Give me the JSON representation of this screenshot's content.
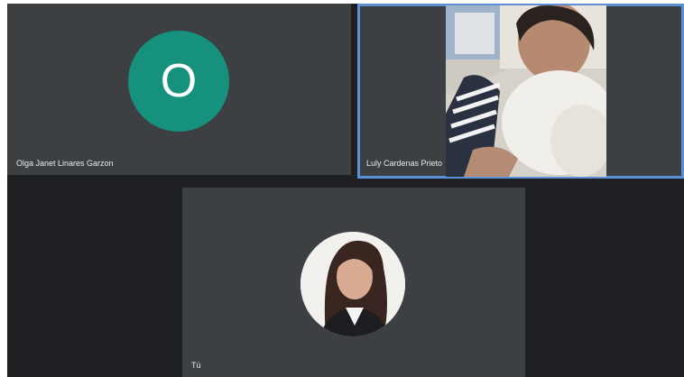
{
  "meeting": {
    "participants": [
      {
        "name": "Olga Janet Linares Garzon",
        "avatar_initial": "O",
        "avatar_color": "#16917e",
        "camera_on": false,
        "speaking": false
      },
      {
        "name": "Luly Cardenas Prieto",
        "camera_on": true,
        "speaking": true
      },
      {
        "name": "Tú",
        "camera_on": false,
        "speaking": false
      }
    ]
  },
  "colors": {
    "background": "#1f2023",
    "tile": "#3c4043",
    "speaking_border": "#5b8fd6"
  }
}
